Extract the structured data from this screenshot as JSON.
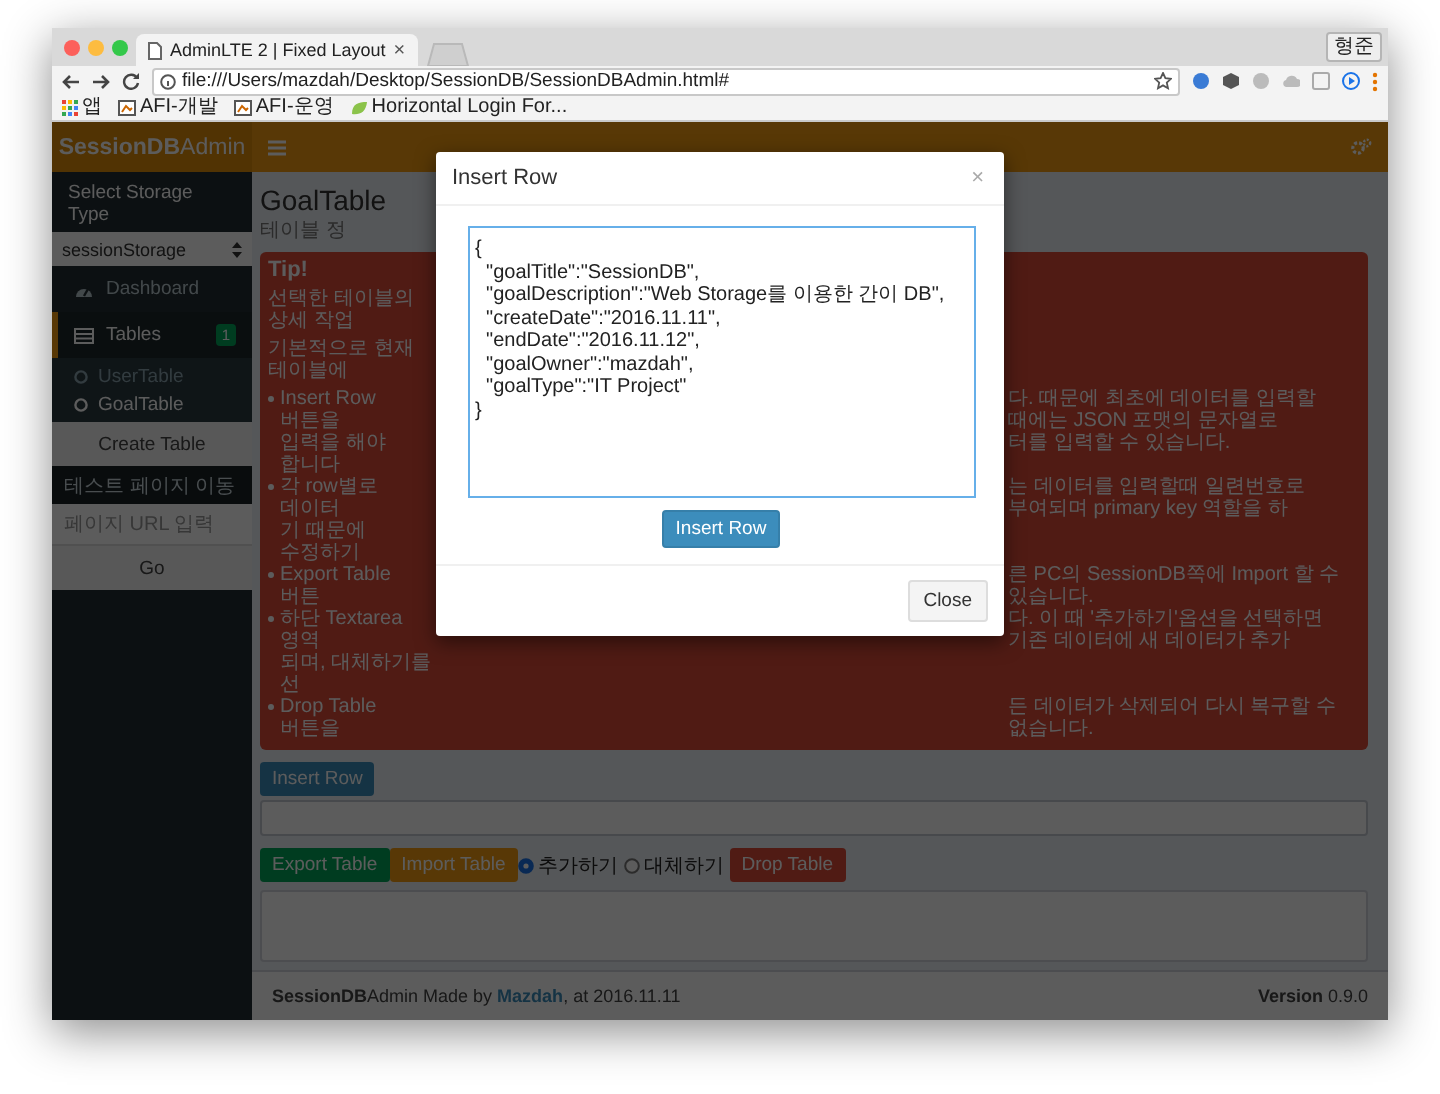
{
  "browser": {
    "tab_title": "AdminLTE 2 | Fixed Layout",
    "tab_close": "×",
    "profile_button": "형준",
    "url": "file:///Users/mazdah/Desktop/SessionDB/SessionDBAdmin.html#",
    "bookmarks": [
      {
        "kind": "apps",
        "label": "앱"
      },
      {
        "kind": "page",
        "label": "AFI-개발"
      },
      {
        "kind": "page",
        "label": "AFI-운영"
      },
      {
        "kind": "leaf",
        "label": "Horizontal Login For..."
      }
    ]
  },
  "sidebar": {
    "logo": "**SessionDB**Admin",
    "storage_label": "Select Storage Type",
    "storage_value": "sessionStorage",
    "menu": [
      {
        "kind": "dashboard",
        "label": "Dashboard",
        "active": false
      },
      {
        "kind": "tables",
        "label": "Tables",
        "badge": "1",
        "active": true,
        "children": [
          {
            "label": "UserTable",
            "selected": false
          },
          {
            "label": "GoalTable",
            "selected": true
          }
        ]
      }
    ],
    "create_button": "Create Table",
    "page_label": "테스트 페이지 이동",
    "url_placeholder": "페이지 URL 입력",
    "go_button": "Go"
  },
  "content": {
    "title": "GoalTable",
    "subtitle": "테이블 정",
    "tip": {
      "title": "Tip!",
      "rows": [
        {
          "kind": "plain",
          "left": "선택한 테이블의 상세 작업"
        },
        {
          "kind": "plain",
          "left": "기본적으로 현재 테이블에"
        },
        {
          "kind": "bullet",
          "left": "Insert Row 버튼을",
          "right": "다. 때문에 최초에 데이터를 입력할 때에는 JSON 포맷의 문자열로"
        },
        {
          "kind": "continuation",
          "left": "입력을 해야 합니다",
          "right": "터를 입력할 수 있습니다."
        },
        {
          "kind": "bullet",
          "left": "각 row별로 데이터",
          "right": "는 데이터를 입력할때 일련번호로 부여되며 primary key 역할을 하"
        },
        {
          "kind": "continuation",
          "left": "기 때문에 수정하기"
        },
        {
          "kind": "bullet",
          "left": "Export Table 버튼",
          "right": "른 PC의 SessionDB쪽에 Import 할 수 있습니다."
        },
        {
          "kind": "bullet",
          "left": "하단 Textarea 영역",
          "right": "다. 이 때 '추가하기'옵션을 선택하면 기존 데이터에 새 데이터가 추가"
        },
        {
          "kind": "continuation",
          "left": "되며, 대체하기를 선"
        },
        {
          "kind": "bullet",
          "left": "Drop Table 버튼을",
          "right": "든 데이터가 삭제되어 다시 복구할 수 없습니다."
        }
      ]
    },
    "insert_button": "Insert Row",
    "actions": [
      {
        "kind": "success",
        "label": "Export Table"
      },
      {
        "kind": "warning",
        "label": "Import Table"
      },
      {
        "kind": "radio",
        "label": "추가하기",
        "selected": true
      },
      {
        "kind": "radio",
        "label": "대체하기",
        "selected": false
      },
      {
        "kind": "danger",
        "label": "Drop Table"
      }
    ]
  },
  "footer": {
    "credit_before": "**SessionDB**Admin Made by ",
    "author": "Mazdah",
    "credit_after": ", at 2016.11.11",
    "version": "**Version** 0.9.0"
  },
  "modal": {
    "title": "Insert Row",
    "close": "×",
    "value": "{\n  \"goalTitle\":\"SessionDB\",\n  \"goalDescription\":\"Web Storage를 이용한 간이 DB\",\n  \"createDate\":\"2016.11.11\",\n  \"endDate\":\"2016.11.12\",\n  \"goalOwner\":\"mazdah\",\n  \"goalType\":\"IT Project\"\n}",
    "submit_button": "Insert Row",
    "close_button": "Close"
  }
}
